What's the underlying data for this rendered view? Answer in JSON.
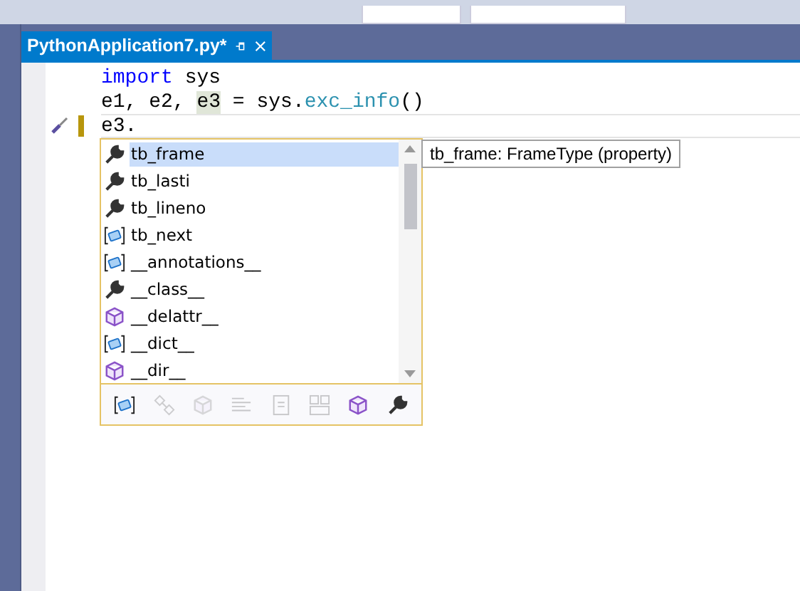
{
  "tab": {
    "title": "PythonApplication7.py*",
    "selected": true
  },
  "code_lines": [
    {
      "current": false,
      "tokens": [
        {
          "kind": "keyword",
          "text": "import"
        },
        {
          "kind": "plain",
          "text": " sys"
        }
      ]
    },
    {
      "current": false,
      "tokens": [
        {
          "kind": "plain",
          "text": "e1, e2, "
        },
        {
          "kind": "highlight",
          "text": "e3"
        },
        {
          "kind": "plain",
          "text": " = sys."
        },
        {
          "kind": "function",
          "text": "exc_info"
        },
        {
          "kind": "plain",
          "text": "()"
        }
      ]
    },
    {
      "current": true,
      "tokens": [
        {
          "kind": "plain",
          "text": "e3."
        }
      ]
    }
  ],
  "completion": {
    "items": [
      {
        "kind": "property",
        "label": "tb_frame",
        "selected": true
      },
      {
        "kind": "property",
        "label": "tb_lasti",
        "selected": false
      },
      {
        "kind": "property",
        "label": "tb_lineno",
        "selected": false
      },
      {
        "kind": "field",
        "label": "tb_next",
        "selected": false
      },
      {
        "kind": "field",
        "label": "__annotations__",
        "selected": false
      },
      {
        "kind": "property",
        "label": "__class__",
        "selected": false
      },
      {
        "kind": "method",
        "label": "__delattr__",
        "selected": false
      },
      {
        "kind": "field",
        "label": "__dict__",
        "selected": false
      },
      {
        "kind": "method",
        "label": "__dir__",
        "selected": false
      }
    ],
    "filters": [
      {
        "kind": "field",
        "enabled": true
      },
      {
        "kind": "links",
        "enabled": false
      },
      {
        "kind": "cube",
        "enabled": false
      },
      {
        "kind": "lines",
        "enabled": false
      },
      {
        "kind": "doc",
        "enabled": false
      },
      {
        "kind": "grid",
        "enabled": false
      },
      {
        "kind": "method",
        "enabled": true
      },
      {
        "kind": "property",
        "enabled": true
      }
    ],
    "tooltip": "tb_frame: FrameType (property)"
  }
}
